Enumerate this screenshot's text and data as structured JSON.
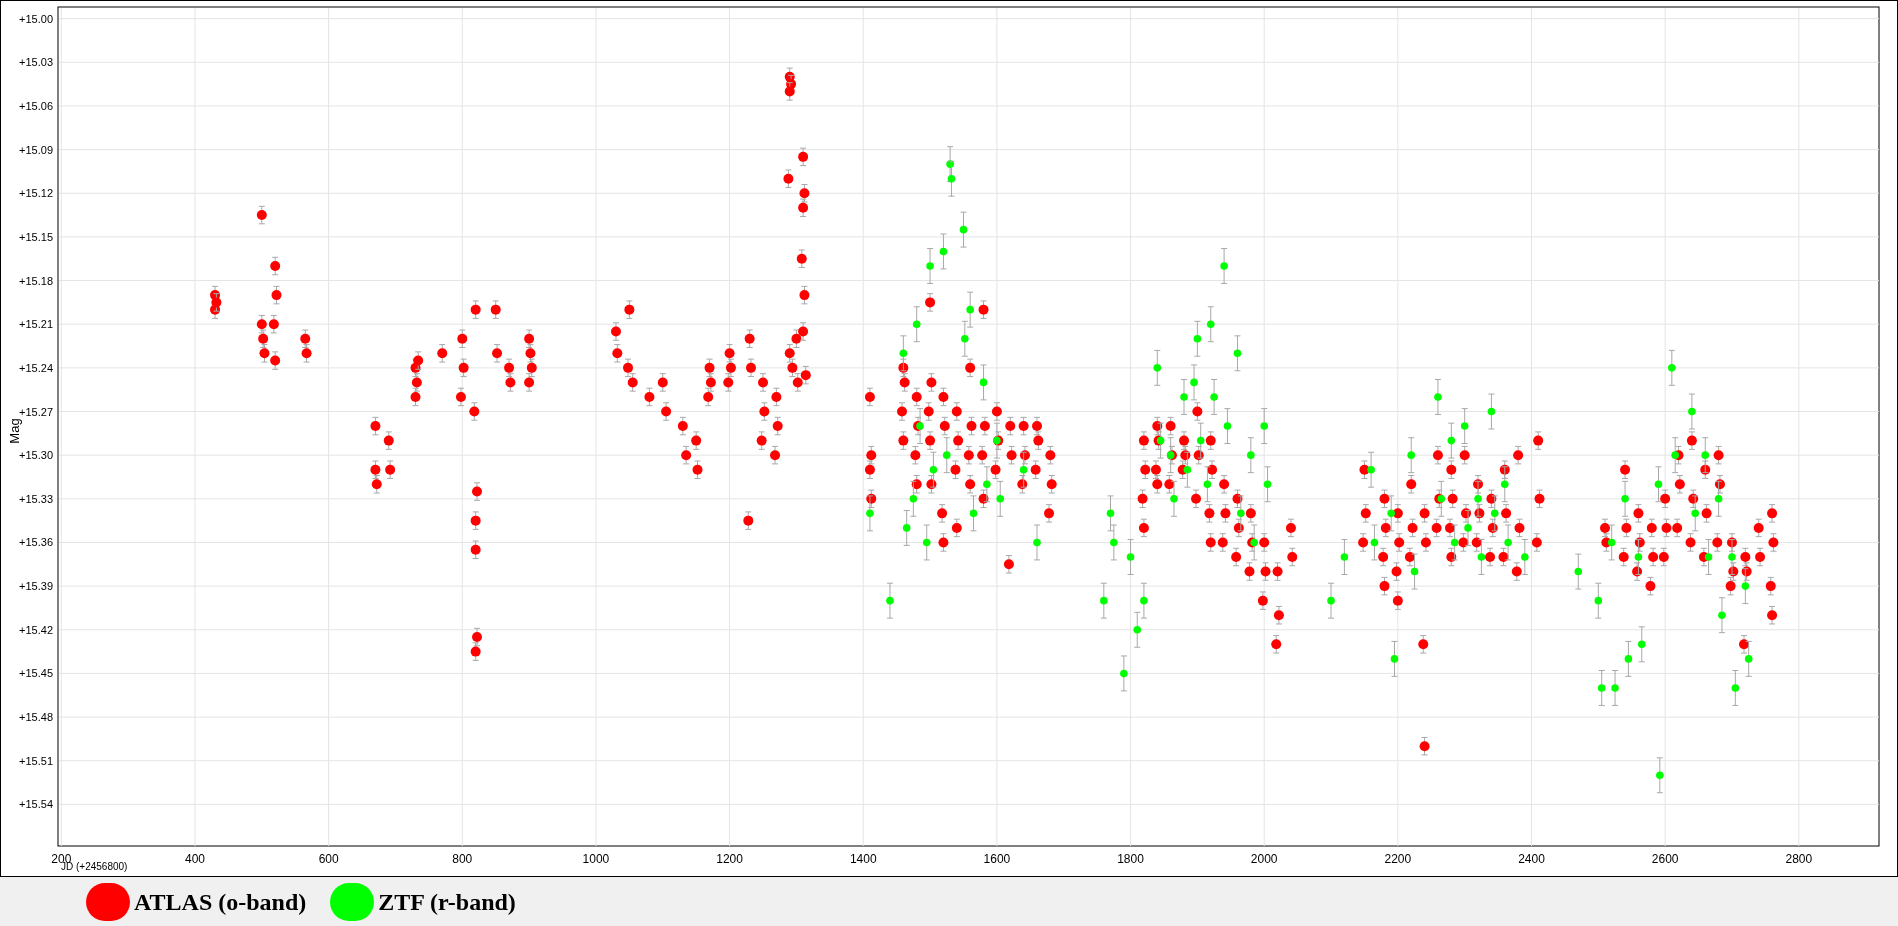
{
  "chart": {
    "chart_data": {
      "type": "scatter",
      "grid": true,
      "xlabel": "JD (+2456800)",
      "ylabel": "Mag",
      "xlim": [
        195,
        2920
      ],
      "ylim": [
        15.5686,
        14.992
      ],
      "xticks": [
        {
          "value": 200,
          "label": "200"
        },
        {
          "value": 400,
          "label": "400"
        },
        {
          "value": 600,
          "label": "600"
        },
        {
          "value": 800,
          "label": "800"
        },
        {
          "value": 1000,
          "label": "1000"
        },
        {
          "value": 1200,
          "label": "1200"
        },
        {
          "value": 1400,
          "label": "1400"
        },
        {
          "value": 1600,
          "label": "1600"
        },
        {
          "value": 1800,
          "label": "1800"
        },
        {
          "value": 2000,
          "label": "2000"
        },
        {
          "value": 2200,
          "label": "2200"
        },
        {
          "value": 2400,
          "label": "2400"
        },
        {
          "value": 2600,
          "label": "2600"
        },
        {
          "value": 2800,
          "label": "2800"
        }
      ],
      "yticks": [
        {
          "value": 15.0,
          "label": "+15.00"
        },
        {
          "value": 15.03,
          "label": "+15.03"
        },
        {
          "value": 15.06,
          "label": "+15.06"
        },
        {
          "value": 15.09,
          "label": "+15.09"
        },
        {
          "value": 15.12,
          "label": "+15.12"
        },
        {
          "value": 15.15,
          "label": "+15.15"
        },
        {
          "value": 15.18,
          "label": "+15.18"
        },
        {
          "value": 15.21,
          "label": "+15.21"
        },
        {
          "value": 15.24,
          "label": "+15.24"
        },
        {
          "value": 15.27,
          "label": "+15.27"
        },
        {
          "value": 15.3,
          "label": "+15.30"
        },
        {
          "value": 15.33,
          "label": "+15.33"
        },
        {
          "value": 15.36,
          "label": "+15.36"
        },
        {
          "value": 15.39,
          "label": "+15.39"
        },
        {
          "value": 15.42,
          "label": "+15.42"
        },
        {
          "value": 15.45,
          "label": "+15.45"
        },
        {
          "value": 15.48,
          "label": "+15.48"
        },
        {
          "value": 15.51,
          "label": "+15.51"
        },
        {
          "value": 15.54,
          "label": "+15.54"
        }
      ],
      "series": [
        {
          "name": "ATLAS (o-band)",
          "color": "#ff0000",
          "x": [
            430,
            430,
            432,
            500,
            500,
            502,
            504,
            520,
            522,
            518,
            520,
            565,
            567,
            670,
            670,
            672,
            690,
            692,
            730,
            732,
            730,
            734,
            770,
            800,
            802,
            798,
            820,
            818,
            822,
            820,
            820,
            822,
            820,
            850,
            852,
            870,
            872,
            900,
            902,
            904,
            900,
            1030,
            1032,
            1050,
            1048,
            1055,
            1080,
            1100,
            1105,
            1130,
            1135,
            1150,
            1152,
            1170,
            1172,
            1168,
            1200,
            1202,
            1198,
            1230,
            1232,
            1228,
            1250,
            1252,
            1248,
            1270,
            1272,
            1268,
            1290,
            1292,
            1290,
            1288,
            1290,
            1294,
            1300,
            1302,
            1310,
            1312,
            1310,
            1308,
            1312,
            1310,
            1314,
            1410,
            1412,
            1410,
            1412,
            1460,
            1462,
            1458,
            1460,
            1480,
            1482,
            1478,
            1480,
            1500,
            1502,
            1498,
            1500,
            1502,
            1520,
            1522,
            1518,
            1520,
            1540,
            1542,
            1538,
            1540,
            1560,
            1562,
            1558,
            1560,
            1580,
            1582,
            1578,
            1580,
            1600,
            1602,
            1598,
            1620,
            1622,
            1618,
            1640,
            1642,
            1638,
            1660,
            1662,
            1658,
            1680,
            1682,
            1678,
            1820,
            1822,
            1818,
            1820,
            1840,
            1842,
            1838,
            1840,
            1860,
            1862,
            1858,
            1880,
            1882,
            1878,
            1900,
            1902,
            1898,
            1920,
            1922,
            1918,
            1920,
            1940,
            1942,
            1938,
            1960,
            1962,
            1958,
            1980,
            1982,
            1978,
            2000,
            2002,
            1998,
            2020,
            2022,
            2018,
            2040,
            2042,
            2150,
            2152,
            2148,
            2180,
            2182,
            2178,
            2180,
            2200,
            2202,
            2198,
            2200,
            2220,
            2222,
            2218,
            2240,
            2242,
            2238,
            2240,
            2260,
            2262,
            2258,
            2280,
            2282,
            2278,
            2280,
            2300,
            2302,
            2298,
            2320,
            2322,
            2318,
            2340,
            2342,
            2338,
            2360,
            2362,
            2358,
            2380,
            2382,
            2378,
            2410,
            2412,
            2408,
            2510,
            2512,
            2540,
            2542,
            2538,
            2560,
            2562,
            2558,
            2580,
            2582,
            2578,
            2600,
            2602,
            2598,
            2620,
            2622,
            2618,
            2640,
            2642,
            2638,
            2660,
            2662,
            2658,
            2680,
            2682,
            2678,
            2700,
            2702,
            2698,
            2720,
            2722,
            2718,
            2740,
            2742,
            2760,
            2762,
            2758,
            2760
          ],
          "values": [
            15.19,
            15.2,
            15.195,
            15.135,
            15.21,
            15.22,
            15.23,
            15.17,
            15.19,
            15.21,
            15.235,
            15.22,
            15.23,
            15.28,
            15.31,
            15.32,
            15.29,
            15.31,
            15.24,
            15.25,
            15.26,
            15.235,
            15.23,
            15.22,
            15.24,
            15.26,
            15.2,
            15.27,
            15.325,
            15.345,
            15.365,
            15.425,
            15.435,
            15.2,
            15.23,
            15.24,
            15.25,
            15.22,
            15.23,
            15.24,
            15.25,
            15.215,
            15.23,
            15.2,
            15.24,
            15.25,
            15.26,
            15.25,
            15.27,
            15.28,
            15.3,
            15.29,
            15.31,
            15.24,
            15.25,
            15.26,
            15.23,
            15.24,
            15.25,
            15.22,
            15.24,
            15.345,
            15.25,
            15.27,
            15.29,
            15.26,
            15.28,
            15.3,
            15.04,
            15.045,
            15.05,
            15.11,
            15.23,
            15.24,
            15.22,
            15.25,
            15.095,
            15.12,
            15.13,
            15.165,
            15.19,
            15.215,
            15.245,
            15.26,
            15.3,
            15.31,
            15.33,
            15.24,
            15.25,
            15.27,
            15.29,
            15.26,
            15.28,
            15.3,
            15.32,
            15.195,
            15.25,
            15.27,
            15.29,
            15.32,
            15.26,
            15.28,
            15.34,
            15.36,
            15.27,
            15.29,
            15.31,
            15.35,
            15.24,
            15.28,
            15.3,
            15.32,
            15.2,
            15.28,
            15.3,
            15.33,
            15.27,
            15.29,
            15.31,
            15.28,
            15.3,
            15.375,
            15.28,
            15.3,
            15.32,
            15.28,
            15.29,
            15.31,
            15.3,
            15.32,
            15.34,
            15.29,
            15.31,
            15.33,
            15.35,
            15.28,
            15.29,
            15.31,
            15.32,
            15.28,
            15.3,
            15.32,
            15.29,
            15.3,
            15.31,
            15.27,
            15.3,
            15.33,
            15.29,
            15.31,
            15.34,
            15.36,
            15.32,
            15.34,
            15.36,
            15.33,
            15.35,
            15.37,
            15.34,
            15.36,
            15.38,
            15.36,
            15.38,
            15.4,
            15.38,
            15.41,
            15.43,
            15.35,
            15.37,
            15.31,
            15.34,
            15.36,
            15.33,
            15.35,
            15.37,
            15.39,
            15.34,
            15.36,
            15.38,
            15.4,
            15.32,
            15.35,
            15.37,
            15.34,
            15.36,
            15.43,
            15.5,
            15.3,
            15.33,
            15.35,
            15.31,
            15.33,
            15.35,
            15.37,
            15.3,
            15.34,
            15.36,
            15.32,
            15.34,
            15.36,
            15.33,
            15.35,
            15.37,
            15.31,
            15.34,
            15.37,
            15.3,
            15.35,
            15.38,
            15.29,
            15.33,
            15.36,
            15.35,
            15.36,
            15.31,
            15.35,
            15.37,
            15.34,
            15.36,
            15.38,
            15.35,
            15.37,
            15.39,
            15.33,
            15.35,
            15.37,
            15.3,
            15.32,
            15.35,
            15.29,
            15.33,
            15.36,
            15.31,
            15.34,
            15.37,
            15.3,
            15.32,
            15.36,
            15.36,
            15.38,
            15.39,
            15.37,
            15.38,
            15.43,
            15.35,
            15.37,
            15.34,
            15.36,
            15.39,
            15.41
          ]
        },
        {
          "name": "ZTF (r-band)",
          "color": "#00ff00",
          "x": [
            1410,
            1440,
            1460,
            1465,
            1480,
            1485,
            1475,
            1500,
            1505,
            1495,
            1520,
            1525,
            1530,
            1532,
            1550,
            1552,
            1560,
            1565,
            1580,
            1585,
            1600,
            1605,
            1640,
            1660,
            1760,
            1770,
            1775,
            1790,
            1800,
            1810,
            1820,
            1840,
            1845,
            1860,
            1865,
            1880,
            1885,
            1900,
            1905,
            1895,
            1920,
            1925,
            1915,
            1940,
            1945,
            1960,
            1965,
            1980,
            1985,
            2000,
            2005,
            2100,
            2120,
            2160,
            2165,
            2190,
            2195,
            2220,
            2225,
            2260,
            2265,
            2280,
            2285,
            2300,
            2305,
            2320,
            2325,
            2340,
            2345,
            2360,
            2365,
            2390,
            2470,
            2500,
            2505,
            2520,
            2525,
            2540,
            2545,
            2560,
            2565,
            2590,
            2592,
            2610,
            2615,
            2640,
            2645,
            2660,
            2665,
            2680,
            2685,
            2700,
            2705,
            2720,
            2725
          ],
          "values": [
            15.34,
            15.4,
            15.23,
            15.35,
            15.21,
            15.28,
            15.33,
            15.17,
            15.31,
            15.36,
            15.16,
            15.3,
            15.1,
            15.11,
            15.145,
            15.22,
            15.2,
            15.34,
            15.25,
            15.32,
            15.29,
            15.33,
            15.31,
            15.36,
            15.4,
            15.34,
            15.36,
            15.45,
            15.37,
            15.42,
            15.4,
            15.24,
            15.29,
            15.3,
            15.33,
            15.26,
            15.31,
            15.22,
            15.29,
            15.25,
            15.21,
            15.26,
            15.32,
            15.17,
            15.28,
            15.23,
            15.34,
            15.3,
            15.36,
            15.28,
            15.32,
            15.4,
            15.37,
            15.31,
            15.36,
            15.34,
            15.44,
            15.3,
            15.38,
            15.26,
            15.33,
            15.29,
            15.36,
            15.28,
            15.35,
            15.33,
            15.37,
            15.27,
            15.34,
            15.32,
            15.36,
            15.37,
            15.38,
            15.4,
            15.46,
            15.36,
            15.46,
            15.33,
            15.44,
            15.37,
            15.43,
            15.32,
            15.52,
            15.24,
            15.3,
            15.27,
            15.34,
            15.3,
            15.37,
            15.33,
            15.41,
            15.37,
            15.46,
            15.39,
            15.44
          ]
        }
      ]
    }
  }
}
